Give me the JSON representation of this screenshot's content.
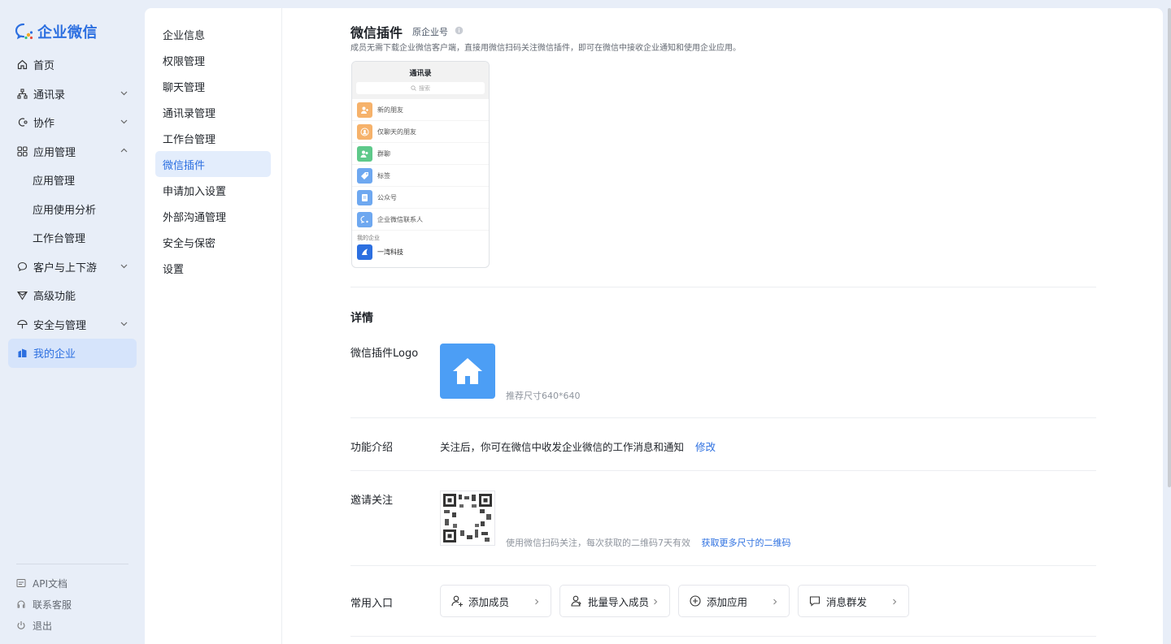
{
  "brand": {
    "name": "企业微信",
    "color": "#2c6fe0"
  },
  "sidebar": {
    "items": [
      {
        "label": "首页",
        "icon": "home-icon"
      },
      {
        "label": "通讯录",
        "icon": "org-chart-icon"
      },
      {
        "label": "协作",
        "icon": "collab-icon"
      },
      {
        "label": "应用管理",
        "icon": "apps-grid-icon"
      },
      {
        "label": "应用管理"
      },
      {
        "label": "应用使用分析"
      },
      {
        "label": "工作台管理"
      },
      {
        "label": "客户与上下游",
        "icon": "chat-bubble-icon"
      },
      {
        "label": "高级功能",
        "icon": "diamond-icon"
      },
      {
        "label": "安全与管理",
        "icon": "umbrella-icon"
      },
      {
        "label": "我的企业",
        "icon": "building-icon"
      }
    ],
    "footer": [
      {
        "label": "API文档",
        "icon": "api-doc-icon"
      },
      {
        "label": "联系客服",
        "icon": "headset-icon"
      },
      {
        "label": "退出",
        "icon": "power-icon"
      }
    ]
  },
  "subnav": {
    "items": [
      "企业信息",
      "权限管理",
      "聊天管理",
      "通讯录管理",
      "工作台管理",
      "微信插件",
      "申请加入设置",
      "外部沟通管理",
      "安全与保密",
      "设置"
    ]
  },
  "main": {
    "title": "微信插件",
    "title_tag": "原企业号",
    "description": "成员无需下载企业微信客户端，直接用微信扫码关注微信插件，即可在微信中接收企业通知和使用企业应用。",
    "phone": {
      "title": "通讯录",
      "search_placeholder": "搜索",
      "items": [
        {
          "label": "新的朋友",
          "color": "#f6b26b"
        },
        {
          "label": "仅聊天的朋友",
          "color": "#f6b26b"
        },
        {
          "label": "群聊",
          "color": "#5ec98a"
        },
        {
          "label": "标签",
          "color": "#6ea8f0"
        },
        {
          "label": "公众号",
          "color": "#6ea8f0"
        },
        {
          "label": "企业微信联系人",
          "color": "#6ea8f0"
        }
      ],
      "section_label": "我的企业",
      "company": "一湾科技"
    },
    "details_title": "详情",
    "logo_label": "微信插件Logo",
    "logo_hint": "推荐尺寸640*640",
    "intro_label": "功能介绍",
    "intro_text": "关注后，你可在微信中收发企业微信的工作消息和通知",
    "intro_edit": "修改",
    "invite_label": "邀请关注",
    "invite_hint": "使用微信扫码关注，每次获取的二维码7天有效",
    "invite_link": "获取更多尺寸的二维码",
    "entries_label": "常用入口",
    "entries": [
      {
        "label": "添加成员",
        "icon": "add-user-icon"
      },
      {
        "label": "批量导入成员",
        "icon": "import-users-icon"
      },
      {
        "label": "添加应用",
        "icon": "add-circle-icon"
      },
      {
        "label": "消息群发",
        "icon": "message-icon"
      }
    ]
  }
}
